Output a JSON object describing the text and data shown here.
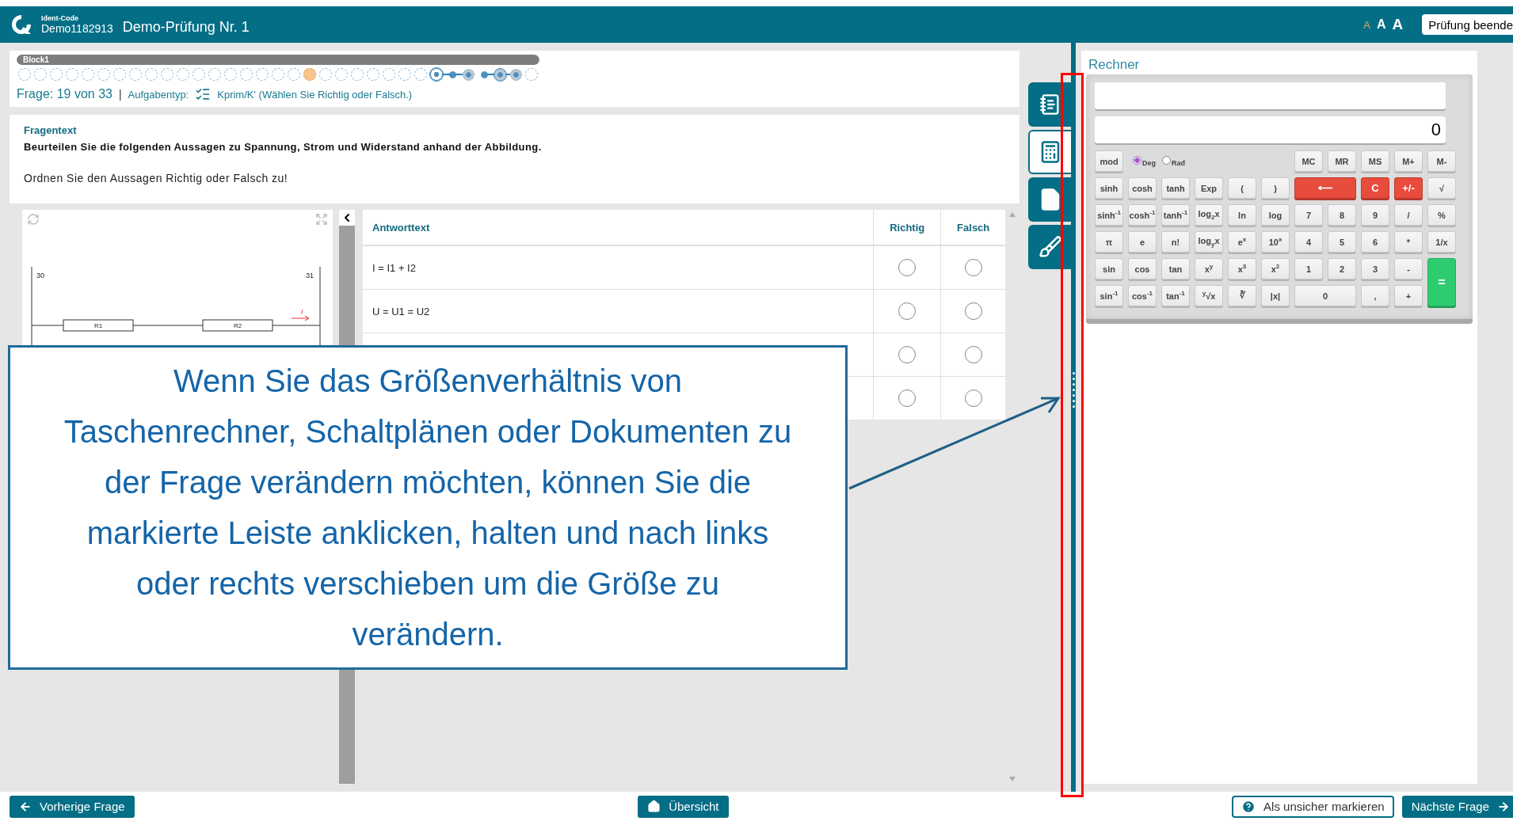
{
  "header": {
    "ident_label": "Ident-Code",
    "ident_code": "Demo1182913",
    "title": "Demo-Prüfung Nr. 1",
    "font_sizes": [
      {
        "label": "A",
        "selected": true
      },
      {
        "label": "A",
        "selected": false
      },
      {
        "label": "A",
        "selected": false
      }
    ],
    "finish_button": "Prüfung beende"
  },
  "progress": {
    "block": "Block1",
    "level": 1,
    "dots": [
      {
        "kind": "open",
        "linked": false
      },
      {
        "kind": "open",
        "linked": false
      },
      {
        "kind": "open",
        "linked": false
      },
      {
        "kind": "open",
        "linked": false
      },
      {
        "kind": "open",
        "linked": false
      },
      {
        "kind": "open",
        "linked": false
      },
      {
        "kind": "open",
        "linked": false
      },
      {
        "kind": "open",
        "linked": false
      },
      {
        "kind": "open",
        "linked": false
      },
      {
        "kind": "open",
        "linked": false
      },
      {
        "kind": "open",
        "linked": false
      },
      {
        "kind": "open",
        "linked": false
      },
      {
        "kind": "open",
        "linked": false
      },
      {
        "kind": "open",
        "linked": false
      },
      {
        "kind": "open",
        "linked": false
      },
      {
        "kind": "open",
        "linked": false
      },
      {
        "kind": "open",
        "linked": false
      },
      {
        "kind": "open",
        "linked": false
      },
      {
        "kind": "current",
        "linked": false
      },
      {
        "kind": "open",
        "linked": false
      },
      {
        "kind": "open",
        "linked": false
      },
      {
        "kind": "open",
        "linked": false
      },
      {
        "kind": "open",
        "linked": false
      },
      {
        "kind": "open",
        "linked": false
      },
      {
        "kind": "open",
        "linked": false
      },
      {
        "kind": "open",
        "linked": false
      },
      {
        "kind": "ring",
        "linked": true
      },
      {
        "kind": "point",
        "linked": true
      },
      {
        "kind": "flagged",
        "linked": false
      },
      {
        "kind": "point",
        "linked": true
      },
      {
        "kind": "flagged",
        "linked": true
      },
      {
        "kind": "flagged",
        "linked": false
      },
      {
        "kind": "open",
        "linked": false
      }
    ]
  },
  "question_info": {
    "counter": "Frage: 19 von 33",
    "separator": "|",
    "type_label": "Aufgabentyp:",
    "type_value": "Kprim/K' (Wählen Sie Richtig oder Falsch.)"
  },
  "question": {
    "heading": "Fragentext",
    "statement": "Beurteilen Sie die folgenden Aussagen zu Spannung, Strom und Widerstand anhand der Abbildung.",
    "instruction": "Ordnen Sie den Aussagen Richtig oder Falsch zu!"
  },
  "figure": {
    "labels": [
      "30",
      "31",
      "R1",
      "R2",
      "I"
    ]
  },
  "answer_table": {
    "columns": [
      "Antworttext",
      "Richtig",
      "Falsch"
    ],
    "rows": [
      {
        "text": "I = I1 + I2",
        "options": [
          {
            "selected": false
          },
          {
            "selected": false
          }
        ]
      },
      {
        "text": "U = U1 = U2",
        "options": [
          {
            "selected": false
          },
          {
            "selected": false
          }
        ]
      },
      {
        "options": [
          {
            "selected": false
          },
          {
            "selected": false
          }
        ]
      },
      {
        "options": [
          {
            "selected": false
          },
          {
            "selected": false
          }
        ]
      }
    ]
  },
  "tools": [
    {
      "kind": "notes",
      "selected": false
    },
    {
      "kind": "calculator",
      "selected": true
    },
    {
      "kind": "document",
      "selected": false
    },
    {
      "kind": "drawing",
      "selected": false
    }
  ],
  "calculator": {
    "title": "Rechner",
    "display": "0",
    "first_key": "mod",
    "angle_modes": [
      {
        "label": "Deg",
        "selected": true
      },
      {
        "label": "Rad",
        "selected": false
      }
    ],
    "memory_keys": [
      "MC",
      "MR",
      "MS",
      "M+",
      "M-"
    ],
    "keys": [
      {
        "label": "sinh",
        "kind": "key"
      },
      {
        "label": "cosh",
        "kind": "key"
      },
      {
        "label": "tanh",
        "kind": "key"
      },
      {
        "label": "Exp",
        "kind": "key"
      },
      {
        "label": "(",
        "kind": "key"
      },
      {
        "label": ")",
        "kind": "key"
      },
      {
        "label": "⟵",
        "kind": "wide-red"
      },
      {
        "label": "C",
        "kind": "red"
      },
      {
        "label": "+/-",
        "kind": "red"
      },
      {
        "label": "√",
        "kind": "key"
      },
      {
        "label": "sinh$^{-1}$",
        "kind": "key"
      },
      {
        "label": "cosh$^{-1}$",
        "kind": "key"
      },
      {
        "label": "tanh$^{-1}$",
        "kind": "key"
      },
      {
        "label": "log$_{2}$x",
        "kind": "key"
      },
      {
        "label": "ln",
        "kind": "key"
      },
      {
        "label": "log",
        "kind": "key"
      },
      {
        "label": "7",
        "kind": "key"
      },
      {
        "label": "8",
        "kind": "key"
      },
      {
        "label": "9",
        "kind": "key"
      },
      {
        "label": "/",
        "kind": "key"
      },
      {
        "label": "%",
        "kind": "key"
      },
      {
        "label": "π",
        "kind": "key"
      },
      {
        "label": "e",
        "kind": "key"
      },
      {
        "label": "n!",
        "kind": "key"
      },
      {
        "label": "log$_{y}$x",
        "kind": "key"
      },
      {
        "label": "e$^{x}$",
        "kind": "key"
      },
      {
        "label": "10$^{x}$",
        "kind": "key"
      },
      {
        "label": "4",
        "kind": "key"
      },
      {
        "label": "5",
        "kind": "key"
      },
      {
        "label": "6",
        "kind": "key"
      },
      {
        "label": "*",
        "kind": "key"
      },
      {
        "label": "1/x",
        "kind": "key"
      },
      {
        "label": "sin",
        "kind": "key"
      },
      {
        "label": "cos",
        "kind": "key"
      },
      {
        "label": "tan",
        "kind": "key"
      },
      {
        "label": "x$^{y}$",
        "kind": "key"
      },
      {
        "label": "x$^{3}$",
        "kind": "key"
      },
      {
        "label": "x$^{2}$",
        "kind": "key"
      },
      {
        "label": "1",
        "kind": "key"
      },
      {
        "label": "2",
        "kind": "key"
      },
      {
        "label": "3",
        "kind": "key"
      },
      {
        "label": "-",
        "kind": "key"
      },
      {
        "label": "=",
        "kind": "equals"
      },
      {
        "label": "sin$^{-1}$",
        "kind": "key"
      },
      {
        "label": "cos$^{-1}$",
        "kind": "key"
      },
      {
        "label": "tan$^{-1}$",
        "kind": "key"
      },
      {
        "label": "$^{y}$√x",
        "kind": "key"
      },
      {
        "label": "∛",
        "kind": "key"
      },
      {
        "label": "|x|",
        "kind": "key"
      },
      {
        "label": "0",
        "kind": "wide"
      },
      {
        "label": ",",
        "kind": "key"
      },
      {
        "label": "+",
        "kind": "key"
      }
    ]
  },
  "footer": {
    "previous": "Vorherige Frage",
    "overview": "Übersicht",
    "mark_unsure": "Als unsicher markieren",
    "next": "Nächste Frage"
  },
  "callout": {
    "text": "Wenn Sie das Größenverhältnis von Taschenrechner, Schaltplänen oder Dokumenten zu der Frage verändern möchten, können Sie die markierte Leiste anklicken, halten und nach links oder rechts verschieben um die Größe zu verändern."
  }
}
